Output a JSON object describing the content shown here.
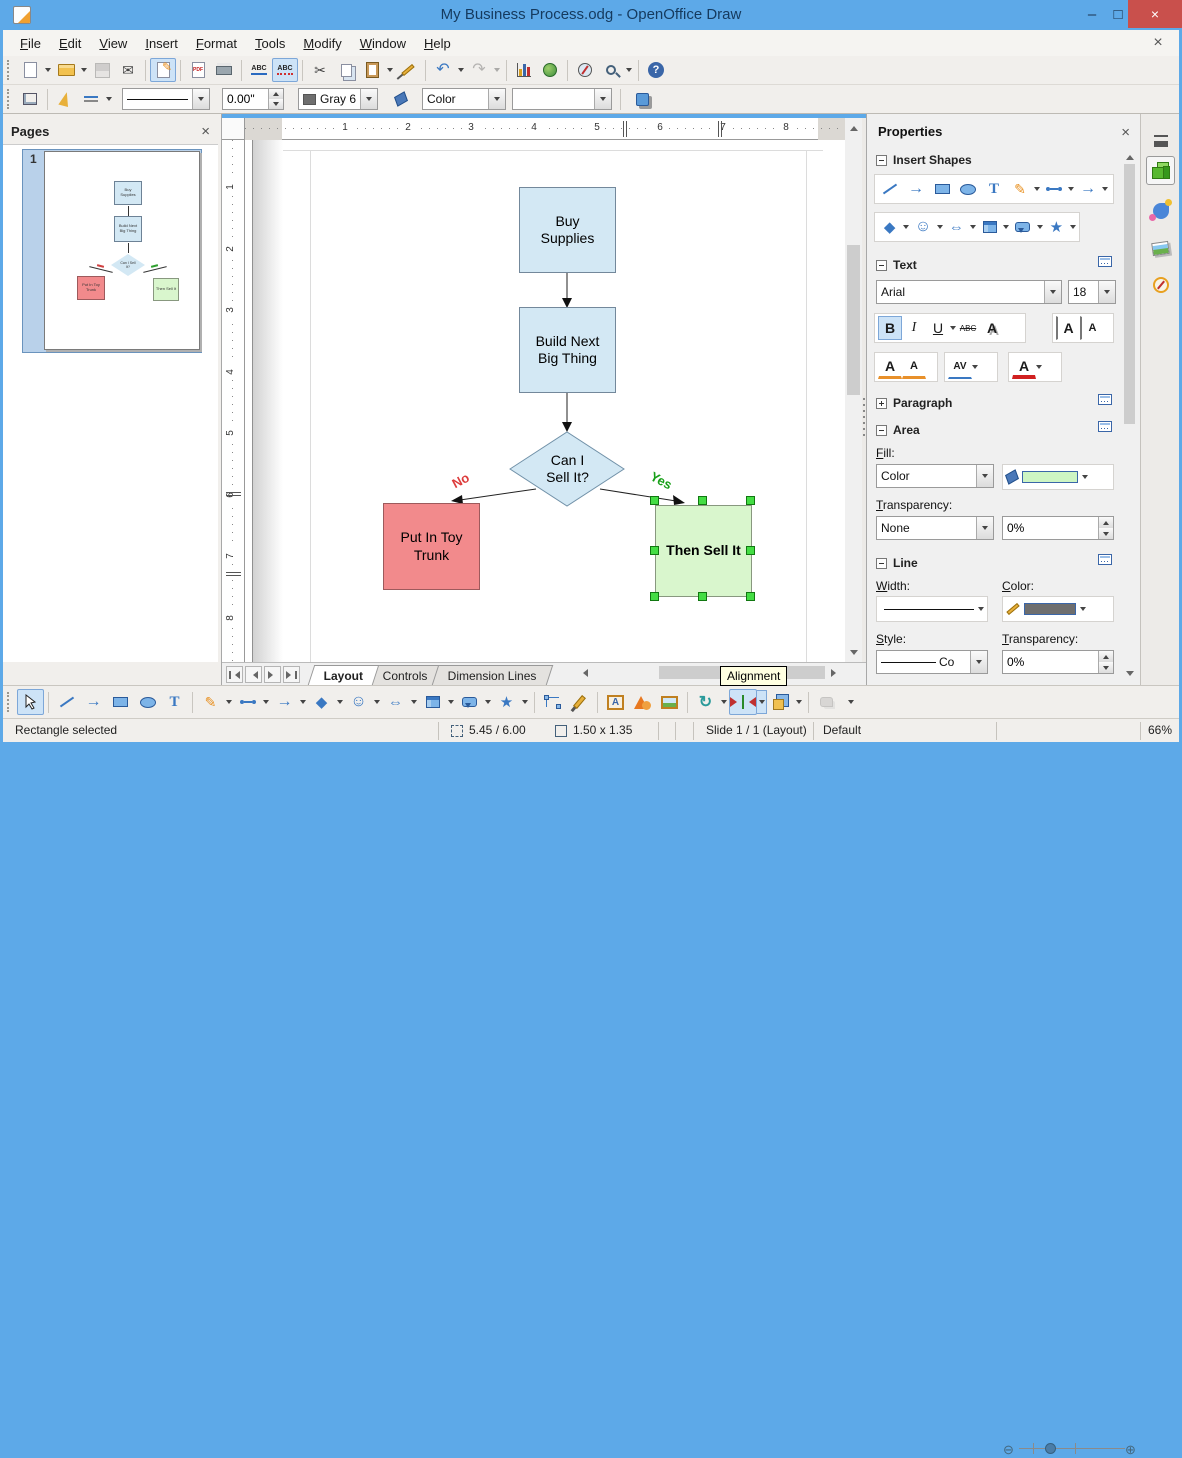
{
  "window": {
    "title": "My Business Process.odg - OpenOffice Draw"
  },
  "menubar": {
    "items": [
      "File",
      "Edit",
      "View",
      "Insert",
      "Format",
      "Tools",
      "Modify",
      "Window",
      "Help"
    ]
  },
  "toolbar2": {
    "line_width": "0.00\"",
    "line_color": "Gray 6",
    "fill_type": "Color"
  },
  "pages": {
    "title": "Pages",
    "page_number": "1"
  },
  "ruler": {
    "h": [
      "1",
      "2",
      "3",
      "4",
      "5",
      "6",
      "7",
      "8"
    ],
    "v": [
      "1",
      "2",
      "3",
      "4",
      "5",
      "6",
      "7",
      "8"
    ]
  },
  "flowchart": {
    "node1": "Buy Supplies",
    "node2": "Build Next Big Thing",
    "decision": "Can I Sell It?",
    "no": "No",
    "yes": "Yes",
    "node3": "Put In Toy Trunk",
    "node4": "Then Sell It"
  },
  "tabs": {
    "layout": "Layout",
    "controls": "Controls",
    "dimension": "Dimension Lines"
  },
  "tooltip": {
    "alignment": "Alignment"
  },
  "properties": {
    "title": "Properties",
    "insert_shapes": {
      "label": "Insert Shapes"
    },
    "text": {
      "label": "Text",
      "font_name": "Arial",
      "font_size": "18",
      "bold": "B",
      "italic": "I",
      "underline": "U",
      "strikethrough": "ABC",
      "shadow": "A"
    },
    "paragraph": {
      "label": "Paragraph"
    },
    "area": {
      "label": "Area",
      "fill_label": "Fill:",
      "fill_type": "Color",
      "transparency_label": "Transparency:",
      "transparency_type": "None",
      "transparency_value": "0%"
    },
    "line": {
      "label": "Line",
      "width_label": "Width:",
      "color_label": "Color:",
      "style_label": "Style:",
      "style_value": "Co",
      "transparency_label": "Transparency:",
      "transparency_value": "0%"
    }
  },
  "statusbar": {
    "status": "Rectangle selected",
    "position": "5.45 / 6.00",
    "size": "1.50 x 1.35",
    "slide": "Slide 1 / 1 (Layout)",
    "style": "Default",
    "zoom": "66%"
  },
  "icons": {
    "minimize": "–",
    "maximize": "□",
    "close": "×",
    "email": "✉",
    "cut": "✂",
    "undo": "↶",
    "redo": "↷",
    "help": "?",
    "pdf": "PDF",
    "abc": "ABC",
    "text_tool": "T",
    "pencil": "✎",
    "arrow_right": "→",
    "diamond": "◆",
    "smiley": "☺",
    "double_arrow": "⇔",
    "star": "★",
    "rotate": "↻",
    "letter_a": "A",
    "av": "AV",
    "fontwork": "A"
  },
  "colors": {
    "titlebar_blue": "#5da9e8",
    "close_red": "#c9504c",
    "shape_blue_fill": "#d3e8f4",
    "shape_red_fill": "#f28a8c",
    "shape_green_fill": "#d9f6cd",
    "selection_handle_green": "#44dd44",
    "no_label_red": "#dd3c3c",
    "yes_label_green": "#18a018",
    "fill_swatch_green": "#cdf5c3",
    "line_swatch_gray": "#6e6e6e",
    "active_button_blue": "#cde3f7",
    "tooltip_yellow": "#ffffe1"
  }
}
